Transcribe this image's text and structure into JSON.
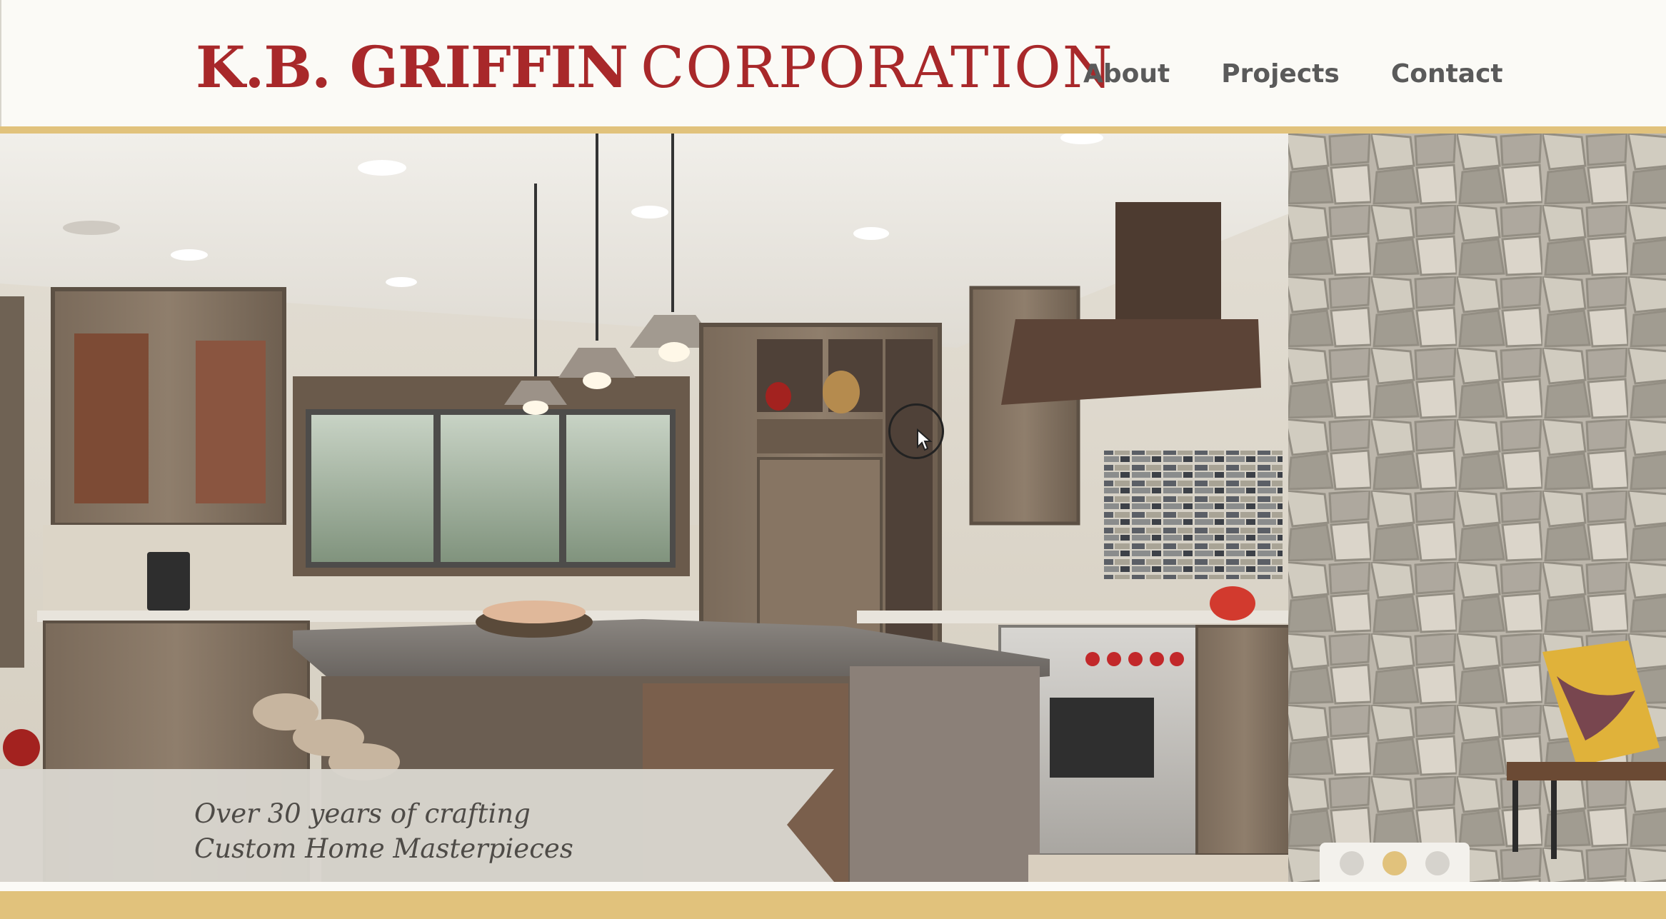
{
  "brand": {
    "name_bold": "K.B. GRIFFIN",
    "name_light": "CORPORATION",
    "color": "#a8282a"
  },
  "nav": {
    "items": [
      "About",
      "Projects",
      "Contact"
    ]
  },
  "hero": {
    "image": "kitchen-interior-photo",
    "caption_line1": "Over 30 years of crafting",
    "caption_line2": "Custom Home Masterpieces"
  },
  "slider": {
    "slides": 3,
    "active_index": 1
  },
  "colors": {
    "accent_gold": "#e1c27c",
    "background": "#fbfaf6",
    "nav_text": "#5a5a5a"
  }
}
